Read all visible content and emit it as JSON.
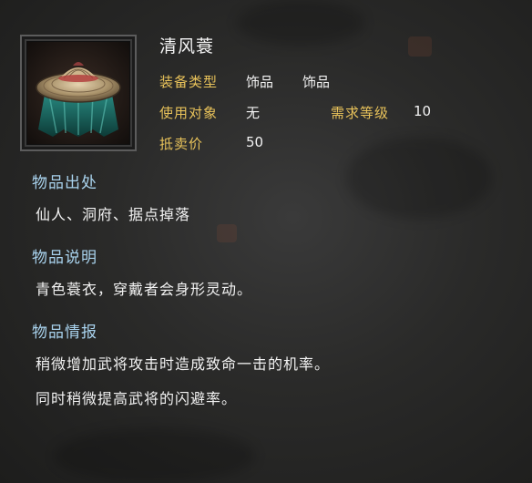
{
  "item": {
    "name": "清风蓑",
    "icon": "straw-hat-cape-icon",
    "equip_type_label": "装备类型",
    "equip_type_value1": "饰品",
    "equip_type_value2": "饰品",
    "target_label": "使用对象",
    "target_value": "无",
    "level_label": "需求等级",
    "level_value": "10",
    "price_label": "抵卖价",
    "price_value": "50"
  },
  "sections": {
    "source_title": "物品出处",
    "source_text": "仙人、洞府、据点掉落",
    "desc_title": "物品说明",
    "desc_text": "青色蓑衣，穿戴者会身形灵动。",
    "info_title": "物品情报",
    "info_line1": "稍微增加武将攻击时造成致命一击的机率。",
    "info_line2": "同时稍微提高武将的闪避率。"
  },
  "colors": {
    "label_gold": "#e8c25a",
    "section_blue": "#a9d3ee",
    "text_white": "#f2f2f2",
    "background": "#2e2e2d"
  }
}
